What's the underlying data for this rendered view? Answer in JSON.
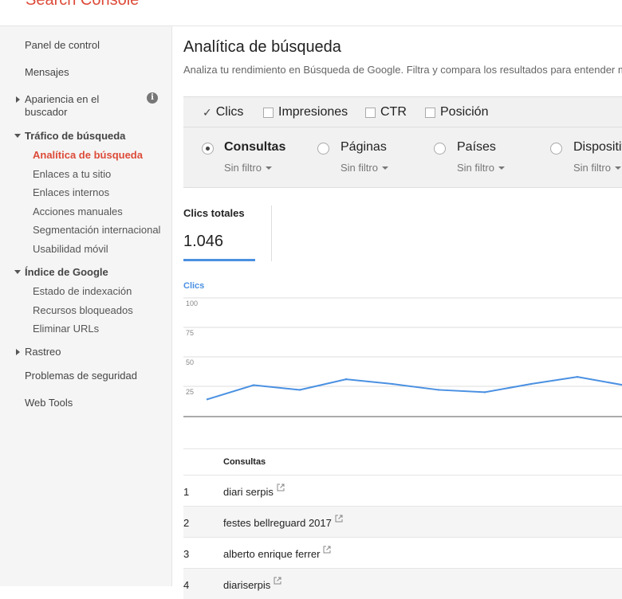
{
  "app": {
    "title": "Search Console"
  },
  "sidebar": {
    "items": [
      {
        "label": "Panel de control"
      },
      {
        "label": "Mensajes"
      },
      {
        "label_line1": "Apariencia en el",
        "label_line2": "buscador"
      }
    ],
    "traffic": {
      "label": "Tráfico de búsqueda",
      "children": [
        {
          "label": "Analítica de búsqueda"
        },
        {
          "label": "Enlaces a tu sitio"
        },
        {
          "label": "Enlaces internos"
        },
        {
          "label": "Acciones manuales"
        },
        {
          "label": "Segmentación internacional"
        },
        {
          "label": "Usabilidad móvil"
        }
      ]
    },
    "index": {
      "label": "Índice de Google",
      "children": [
        {
          "label": "Estado de indexación"
        },
        {
          "label": "Recursos bloqueados"
        },
        {
          "label": "Eliminar URLs"
        }
      ]
    },
    "crawl": {
      "label": "Rastreo"
    },
    "security": {
      "label": "Problemas de seguridad"
    },
    "webtools": {
      "label": "Web Tools"
    }
  },
  "main": {
    "title": "Analítica de búsqueda",
    "subtitle": "Analiza tu rendimiento en Búsqueda de Google. Filtra y compara los resultados para entender mejor",
    "metrics": [
      {
        "label": "Clics",
        "checked": true
      },
      {
        "label": "Impresiones",
        "checked": false
      },
      {
        "label": "CTR",
        "checked": false
      },
      {
        "label": "Posición",
        "checked": false
      }
    ],
    "dimensions": [
      {
        "label": "Consultas",
        "selected": true,
        "filter": "Sin filtro"
      },
      {
        "label": "Páginas",
        "selected": false,
        "filter": "Sin filtro"
      },
      {
        "label": "Países",
        "selected": false,
        "filter": "Sin filtro"
      },
      {
        "label": "Dispositivos",
        "selected": false,
        "filter": "Sin filtro"
      }
    ],
    "total_card": {
      "label": "Clics totales",
      "value": "1.046"
    },
    "chart_label": "Clics",
    "table": {
      "header": "Consultas",
      "rows": [
        {
          "num": "1",
          "query": "diari serpis"
        },
        {
          "num": "2",
          "query": "festes bellreguard 2017"
        },
        {
          "num": "3",
          "query": "alberto enrique ferrer"
        },
        {
          "num": "4",
          "query": "diariserpis"
        }
      ]
    }
  },
  "colors": {
    "accent": "#dd4b39",
    "line": "#4a90e2"
  },
  "chart_data": {
    "type": "line",
    "title": "",
    "ylabel": "Clics",
    "ylim": [
      0,
      100
    ],
    "yticks": [
      25,
      50,
      75,
      100
    ],
    "series": [
      {
        "name": "Clics",
        "values": [
          14,
          26,
          22,
          31,
          27,
          22,
          20,
          27,
          33,
          26
        ]
      }
    ]
  }
}
